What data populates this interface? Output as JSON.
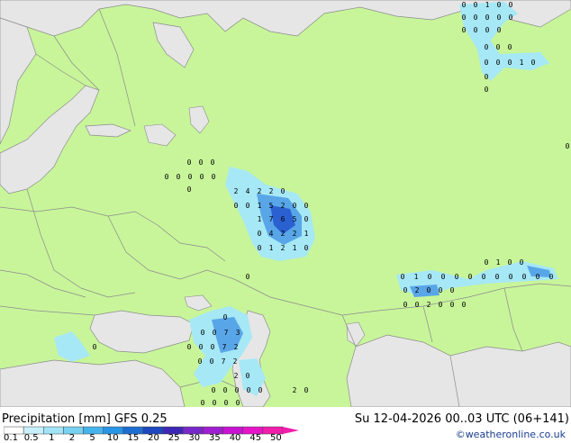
{
  "header": {
    "title_left": "Precipitation [mm]  GFS 0.25",
    "title_right": "Su 12-04-2026 00..03 UTC (06+141)",
    "credit": "©weatheronline.co.uk"
  },
  "colors": {
    "land": "#c8f59a",
    "sea": "#e6e6e6",
    "border": "#8c8c8c",
    "precip_light": "#a6e8f5",
    "precip_mid": "#58a6e8",
    "precip_heavy": "#2a60d0"
  },
  "legend": {
    "labels": [
      "0.1",
      "0.5",
      "1",
      "2",
      "5",
      "10",
      "15",
      "20",
      "25",
      "30",
      "35",
      "40",
      "45",
      "50"
    ],
    "colors": [
      "#ffffff",
      "#c8f0fa",
      "#a0e4f5",
      "#78d2f0",
      "#46b4ec",
      "#2896e6",
      "#1e6ed2",
      "#1e46be",
      "#3c28b4",
      "#7828c8",
      "#a01ed2",
      "#c814d2",
      "#e614c8",
      "#f01eaa"
    ]
  },
  "map": {
    "cell_values": [
      {
        "group": "ne-top",
        "row": [
          "0",
          "0",
          "1",
          "0",
          "0"
        ]
      },
      {
        "group": "ne-top",
        "row": [
          "0",
          "0",
          "0",
          "0",
          "0"
        ]
      },
      {
        "group": "ne-top",
        "row": [
          "0",
          "0",
          "0",
          "0"
        ]
      },
      {
        "group": "ne-top",
        "row": [
          "0",
          "0",
          "0"
        ]
      },
      {
        "group": "ne-top",
        "row": [
          "0",
          "0",
          "0",
          "1",
          "0"
        ]
      },
      {
        "group": "ne-top",
        "row": [
          "0"
        ]
      },
      {
        "group": "ne-top",
        "row": [
          "0"
        ]
      },
      {
        "group": "west",
        "row": [
          "0",
          "0",
          "0"
        ]
      },
      {
        "group": "west",
        "row": [
          "0",
          "0",
          "0",
          "0",
          "0"
        ]
      },
      {
        "group": "west",
        "row": [
          "0"
        ]
      },
      {
        "group": "center",
        "row": [
          "2",
          "4",
          "2",
          "2",
          "0"
        ]
      },
      {
        "group": "center",
        "row": [
          "0",
          "0",
          "1",
          "5",
          "2",
          "0",
          "0"
        ]
      },
      {
        "group": "center",
        "row": [
          "1",
          "7",
          "6",
          "5",
          "0"
        ]
      },
      {
        "group": "center",
        "row": [
          "0",
          "4",
          "2",
          "2",
          "1"
        ]
      },
      {
        "group": "center",
        "row": [
          "0",
          "1",
          "2",
          "1",
          "0"
        ]
      },
      {
        "group": "east",
        "row": [
          "0",
          "1",
          "0",
          "0"
        ]
      },
      {
        "group": "east",
        "row": [
          "0",
          "1",
          "0",
          "0",
          "0",
          "0",
          "0",
          "0",
          "0",
          "0",
          "0",
          "0"
        ]
      },
      {
        "group": "east",
        "row": [
          "0",
          "2",
          "0",
          "0",
          "0"
        ]
      },
      {
        "group": "east",
        "row": [
          "0",
          "0",
          "2",
          "0",
          "0",
          "0"
        ]
      },
      {
        "group": "south",
        "row": [
          "0"
        ]
      },
      {
        "group": "south",
        "row": [
          "0",
          "0",
          "7",
          "3"
        ]
      },
      {
        "group": "south",
        "row": [
          "0",
          "0",
          "0",
          "7",
          "2"
        ]
      },
      {
        "group": "south",
        "row": [
          "0"
        ]
      },
      {
        "group": "south",
        "row": [
          "0",
          "0",
          "7",
          "2"
        ]
      },
      {
        "group": "south",
        "row": [
          "2",
          "0"
        ]
      },
      {
        "group": "south",
        "row": [
          "0",
          "0",
          "0",
          "0",
          "0"
        ]
      },
      {
        "group": "south",
        "row": [
          "2",
          "0"
        ]
      },
      {
        "group": "south",
        "row": [
          "0",
          "0",
          "0",
          "0"
        ]
      },
      {
        "group": "misc",
        "row": [
          "0"
        ]
      },
      {
        "group": "misc",
        "row": [
          "0"
        ]
      }
    ]
  }
}
